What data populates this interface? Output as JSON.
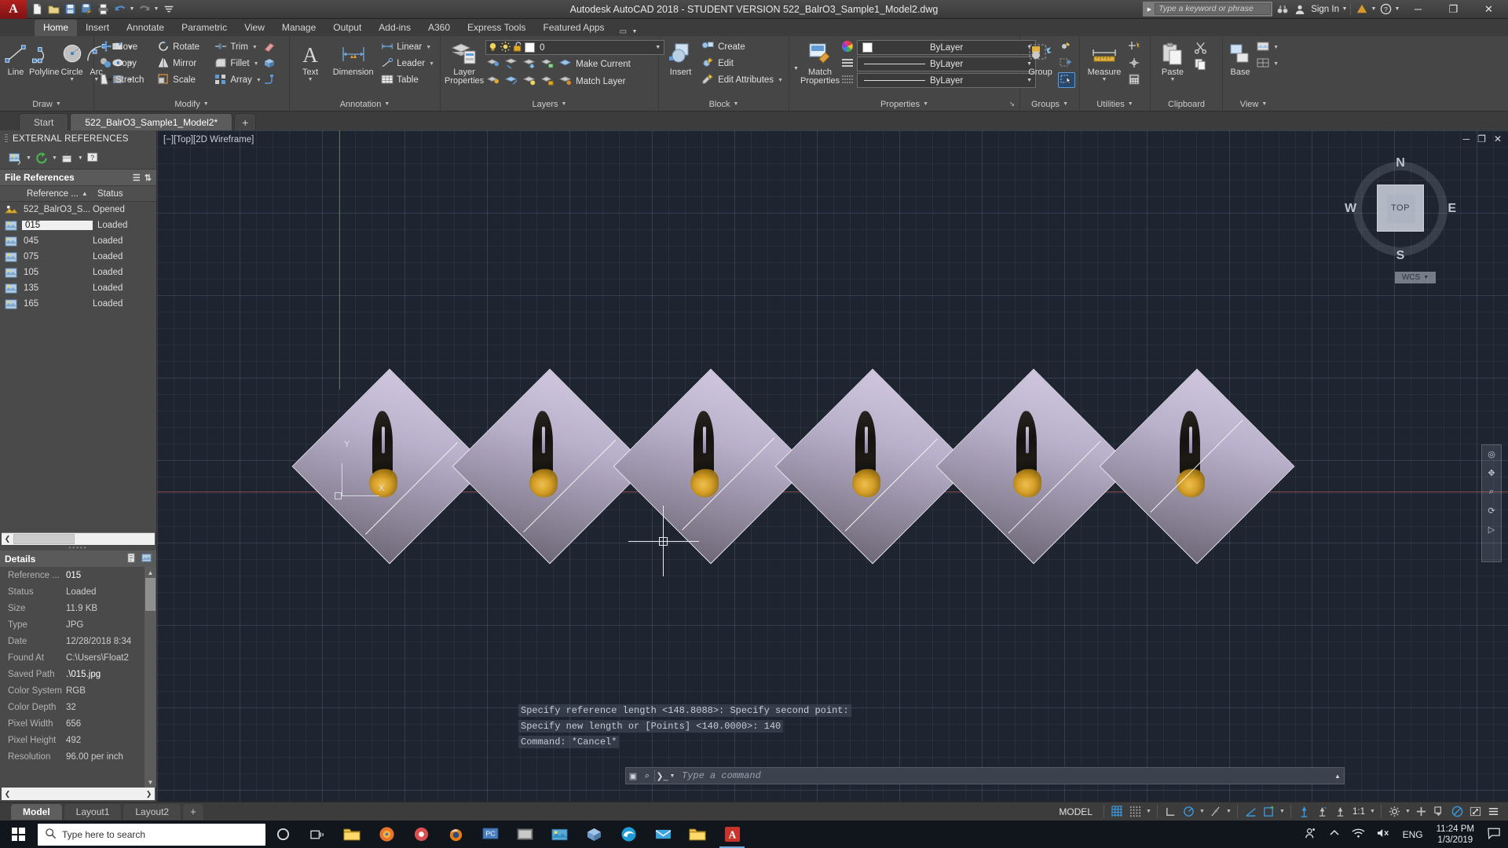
{
  "titlebar": {
    "app_icon": "autocad-a-logo",
    "title": "Autodesk AutoCAD 2018 - STUDENT VERSION    522_BalrO3_Sample1_Model2.dwg",
    "quick_access": [
      {
        "name": "new",
        "glyph": "▢"
      },
      {
        "name": "open",
        "glyph": "▤"
      },
      {
        "name": "save",
        "glyph": "▣"
      },
      {
        "name": "save-as",
        "glyph": "▥"
      },
      {
        "name": "plot",
        "glyph": "▦"
      },
      {
        "name": "undo",
        "glyph": "↩"
      },
      {
        "name": "redo",
        "glyph": "↪"
      },
      {
        "name": "customize",
        "glyph": "▼"
      }
    ],
    "search_placeholder": "Type a keyword or phrase",
    "sign_in": "Sign In",
    "window_buttons": {
      "minimize": "─",
      "maximize": "❐",
      "close": "✕"
    }
  },
  "ribbon_tabs": [
    {
      "label": "Home",
      "active": true
    },
    {
      "label": "Insert",
      "active": false
    },
    {
      "label": "Annotate",
      "active": false
    },
    {
      "label": "Parametric",
      "active": false
    },
    {
      "label": "View",
      "active": false
    },
    {
      "label": "Manage",
      "active": false
    },
    {
      "label": "Output",
      "active": false
    },
    {
      "label": "Add-ins",
      "active": false
    },
    {
      "label": "A360",
      "active": false
    },
    {
      "label": "Express Tools",
      "active": false
    },
    {
      "label": "Featured Apps",
      "active": false
    }
  ],
  "ribbon": {
    "draw": {
      "title": "Draw",
      "big": [
        {
          "label": "Line",
          "icon": "line-icon"
        },
        {
          "label": "Polyline",
          "icon": "polyline-icon"
        },
        {
          "label": "Circle",
          "icon": "circle-icon",
          "has_caret": true
        },
        {
          "label": "Arc",
          "icon": "arc-icon",
          "has_caret": true
        }
      ],
      "small": [
        {
          "icon": "rectangle-icon"
        },
        {
          "icon": "ellipse-icon"
        },
        {
          "icon": "hatch-icon"
        }
      ]
    },
    "modify": {
      "title": "Modify",
      "items": [
        {
          "label": "Move",
          "icon": "move-icon"
        },
        {
          "label": "Rotate",
          "icon": "rotate-icon"
        },
        {
          "label": "Trim",
          "icon": "trim-icon"
        },
        {
          "label": "Copy",
          "icon": "copy-icon"
        },
        {
          "label": "Mirror",
          "icon": "mirror-icon"
        },
        {
          "label": "Fillet",
          "icon": "fillet-icon"
        },
        {
          "label": "Stretch",
          "icon": "stretch-icon"
        },
        {
          "label": "Scale",
          "icon": "scale-icon"
        },
        {
          "label": "Array",
          "icon": "array-icon"
        }
      ],
      "extra_icons": [
        "erase-icon",
        "3d-solid-icon",
        "explode-icon"
      ]
    },
    "annotation": {
      "title": "Annotation",
      "big": [
        {
          "label": "Text",
          "icon": "text-icon",
          "has_caret": true
        },
        {
          "label": "Dimension",
          "icon": "dimension-icon"
        }
      ],
      "small": [
        {
          "label": "Linear",
          "icon": "linear-dim-icon",
          "has_caret": true
        },
        {
          "label": "Leader",
          "icon": "leader-icon",
          "has_caret": true
        },
        {
          "label": "Table",
          "icon": "table-icon"
        }
      ]
    },
    "layers": {
      "title": "Layers",
      "big": {
        "label": "Layer\nProperties",
        "icon": "layer-properties-icon"
      },
      "current_layer": "0",
      "state_icons": [
        "lightbulb-icon",
        "sun-icon",
        "unlock-icon"
      ],
      "small": [
        {
          "label": "Make Current",
          "icon": "make-current-icon"
        },
        {
          "label": "Match Layer",
          "icon": "match-layer-icon"
        }
      ],
      "tool_icons": [
        "layer-isolate-icon",
        "layer-off-icon",
        "layer-freeze-icon",
        "layer-lock-icon",
        "layer-unisolate-icon",
        "layer-on-icon",
        "layer-merge-icon",
        "layer-thaw-icon",
        "layer-unlock-icon",
        "layer-delete-icon"
      ]
    },
    "block": {
      "title": "Block",
      "big": {
        "label": "Insert",
        "icon": "insert-block-icon"
      },
      "small": [
        {
          "label": "Create",
          "icon": "create-block-icon"
        },
        {
          "label": "Edit",
          "icon": "edit-block-icon"
        },
        {
          "label": "Edit Attributes",
          "icon": "edit-attributes-icon",
          "has_caret": true
        }
      ]
    },
    "properties": {
      "title": "Properties",
      "big": {
        "label": "Match\nProperties",
        "icon": "match-properties-icon"
      },
      "color": "ByLayer",
      "linetype": "ByLayer",
      "lineweight": "ByLayer",
      "color_swatch": "#ffffff"
    },
    "groups": {
      "title": "Groups",
      "big": {
        "label": "Group",
        "icon": "group-icon"
      },
      "small_icons": [
        "ungroup-icon",
        "group-edit-icon",
        "group-selection-icon"
      ]
    },
    "utilities": {
      "title": "Utilities",
      "big": {
        "label": "Measure",
        "icon": "measure-icon",
        "has_caret": true
      },
      "small_icons": [
        "quick-measure-icon",
        "id-point-icon",
        "calculator-icon"
      ]
    },
    "clipboard": {
      "title": "Clipboard",
      "big": {
        "label": "Paste",
        "icon": "paste-icon",
        "has_caret": true
      },
      "small_icons": [
        "cut-icon",
        "copy-clip-icon"
      ]
    },
    "view": {
      "title": "View",
      "big": {
        "label": "Base",
        "icon": "base-view-icon"
      },
      "small_icons": [
        "named-view-icon",
        "viewport-icon"
      ]
    }
  },
  "file_tabs": [
    {
      "label": "Start",
      "active": false
    },
    {
      "label": "522_BalrO3_Sample1_Model2*",
      "active": true
    },
    {
      "label": "+",
      "active": false
    }
  ],
  "palette": {
    "title": "EXTERNAL REFERENCES",
    "toolbar_icons": [
      "attach-dwg-icon",
      "refresh-icon",
      "change-path-icon",
      "help-icon"
    ],
    "file_references": {
      "section_title": "File References",
      "view_icons": [
        "list-view-icon",
        "tree-view-icon"
      ],
      "columns": [
        "Reference ...",
        "Status"
      ],
      "sort_indicator": "▲",
      "rows": [
        {
          "icon": "dwg-icon",
          "name": "522_BalrO3_S...",
          "status": "Opened",
          "selected": false
        },
        {
          "icon": "image-icon",
          "name": "015",
          "status": "Loaded",
          "selected": true
        },
        {
          "icon": "image-icon",
          "name": "045",
          "status": "Loaded",
          "selected": false
        },
        {
          "icon": "image-icon",
          "name": "075",
          "status": "Loaded",
          "selected": false
        },
        {
          "icon": "image-icon",
          "name": "105",
          "status": "Loaded",
          "selected": false
        },
        {
          "icon": "image-icon",
          "name": "135",
          "status": "Loaded",
          "selected": false
        },
        {
          "icon": "image-icon",
          "name": "165",
          "status": "Loaded",
          "selected": false
        }
      ]
    },
    "details": {
      "section_title": "Details",
      "header_icons": [
        "details-view-icon",
        "preview-view-icon"
      ],
      "rows": [
        {
          "key": "Reference ...",
          "value": "015",
          "highlight": true
        },
        {
          "key": "Status",
          "value": "Loaded",
          "highlight": false
        },
        {
          "key": "Size",
          "value": "11.9 KB",
          "highlight": false
        },
        {
          "key": "Type",
          "value": "JPG",
          "highlight": false
        },
        {
          "key": "Date",
          "value": "12/28/2018 8:34",
          "highlight": false
        },
        {
          "key": "Found At",
          "value": "C:\\Users\\Float2",
          "highlight": false
        },
        {
          "key": "Saved Path",
          "value": ".\\015.jpg",
          "highlight": true
        },
        {
          "key": "Color System",
          "value": "RGB",
          "highlight": false
        },
        {
          "key": "Color Depth",
          "value": "32",
          "highlight": false
        },
        {
          "key": "Pixel Width",
          "value": "656",
          "highlight": false
        },
        {
          "key": "Pixel Height",
          "value": "492",
          "highlight": false
        },
        {
          "key": "Resolution",
          "value": "96.00 per inch",
          "highlight": false
        }
      ]
    }
  },
  "canvas": {
    "viewport_label": "[−][Top][2D Wireframe]",
    "window_buttons": {
      "minimize": "─",
      "restore": "❐",
      "close": "✕"
    },
    "viewcube": {
      "top_face": "TOP",
      "north": "N",
      "south": "S",
      "west": "W",
      "east": "E",
      "wcs_label": "WCS"
    },
    "ucs": {
      "x_label": "X",
      "y_label": "Y"
    },
    "navbar_icons": [
      "full-navigation-wheel-icon",
      "pan-icon",
      "zoom-extents-icon",
      "orbit-icon",
      "showmotion-icon"
    ],
    "images": [
      {
        "name": "015"
      },
      {
        "name": "045"
      },
      {
        "name": "075"
      },
      {
        "name": "105"
      },
      {
        "name": "135"
      },
      {
        "name": "165"
      }
    ]
  },
  "command": {
    "history": [
      "Specify reference length <148.8088>:  Specify second point:",
      "Specify new length or [Points] <140.0000>: 140",
      "Command: *Cancel*"
    ],
    "placeholder": "Type a command",
    "left_icons": [
      "customize-icon",
      "search-cmd-icon"
    ],
    "prompt_icon": "❯_"
  },
  "layout_tabs": [
    {
      "label": "Model",
      "active": true
    },
    {
      "label": "Layout1",
      "active": false
    },
    {
      "label": "Layout2",
      "active": false
    },
    {
      "label": "+",
      "active": false
    }
  ],
  "statusbar": {
    "model_label": "MODEL",
    "scale": "1:1",
    "icons": [
      {
        "name": "grid-display-icon",
        "glyph": "▦",
        "on": true
      },
      {
        "name": "snap-mode-icon",
        "glyph": "⠿",
        "on": false
      },
      {
        "name": "ortho-mode-icon",
        "glyph": "⌐",
        "on": false
      },
      {
        "name": "polar-tracking-icon",
        "glyph": "◴",
        "on": true
      },
      {
        "name": "object-snap-tracking-icon",
        "glyph": "∖",
        "on": false
      },
      {
        "name": "osnap-icon",
        "glyph": "∠",
        "on": true
      },
      {
        "name": "ucs-icon",
        "glyph": "▣",
        "on": true
      },
      {
        "name": "annotation-visibility-icon",
        "glyph": "⚘",
        "on": true
      },
      {
        "name": "autoscale-icon",
        "glyph": "⚘",
        "on": false
      },
      {
        "name": "annotation-scale-icon",
        "glyph": "⚘",
        "on": false
      },
      {
        "name": "workspace-switch-icon",
        "glyph": "✲",
        "on": false
      },
      {
        "name": "hardware-accel-icon",
        "glyph": "✛",
        "on": false
      },
      {
        "name": "isolate-objects-icon",
        "glyph": "▨",
        "on": false
      },
      {
        "name": "clean-screen-icon",
        "glyph": "◓",
        "on": true
      },
      {
        "name": "fullscreen-icon",
        "glyph": "⤢",
        "on": false
      },
      {
        "name": "customization-icon",
        "glyph": "☰",
        "on": false
      }
    ]
  },
  "taskbar": {
    "search_placeholder": "Type here to search",
    "search_icon": "search-icon",
    "cortana_icon": "cortana-icon",
    "taskview_icon": "task-view-icon",
    "apps": [
      {
        "name": "file-explorer",
        "glyph": "🗀",
        "color": "#f2c14a",
        "active": false
      },
      {
        "name": "firefox",
        "glyph": "◉",
        "color": "#e8732b",
        "active": false
      },
      {
        "name": "settings-app",
        "glyph": "✹",
        "color": "#d94f4f",
        "active": false
      },
      {
        "name": "blender",
        "glyph": "◐",
        "color": "#e87d0d",
        "active": false
      },
      {
        "name": "pc-app",
        "glyph": "▣",
        "color": "#5b8fd4",
        "active": false
      },
      {
        "name": "media-player",
        "glyph": "▭",
        "color": "#8a8a8a",
        "active": false
      },
      {
        "name": "photos",
        "glyph": "▥",
        "color": "#5aa9d6",
        "active": false
      },
      {
        "name": "3d-viewer",
        "glyph": "◆",
        "color": "#7fb3d5",
        "active": false
      },
      {
        "name": "edge",
        "glyph": "e",
        "color": "#1f9bd6",
        "active": false
      },
      {
        "name": "mail",
        "glyph": "✉",
        "color": "#3ba5e0",
        "active": false
      },
      {
        "name": "file-explorer-2",
        "glyph": "🗀",
        "color": "#f2c14a",
        "active": false
      },
      {
        "name": "autocad",
        "glyph": "A",
        "color": "#c7342b",
        "active": true
      }
    ],
    "tray": {
      "people_icon": "people-icon",
      "chevron_icon": "show-hidden-icons",
      "wifi_icon": "wifi-icon",
      "volume_icon": "volume-muted-icon",
      "language": "ENG",
      "time": "11:24 PM",
      "date": "1/3/2019",
      "notifications_icon": "action-center-icon"
    }
  }
}
